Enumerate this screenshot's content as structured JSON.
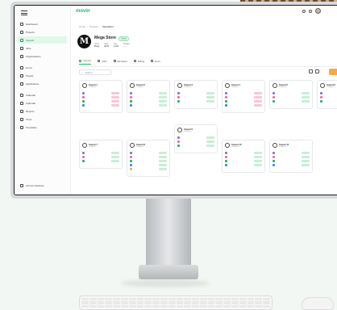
{
  "app": {
    "logo": "movin"
  },
  "colors": {
    "accent": "#27b36a",
    "accent_soft": "#e3f6ea",
    "cta": "#f7a94a",
    "frame": "#d7d9dc"
  },
  "sidebar": {
    "items": [
      {
        "label": "Dashboard",
        "icon": "grid-icon",
        "active": false
      },
      {
        "label": "Projects",
        "icon": "folder-icon",
        "active": false
      },
      {
        "label": "Squads",
        "icon": "users-icon",
        "active": true
      },
      {
        "label": "Jobs",
        "icon": "briefcase-icon",
        "active": false
      },
      {
        "label": "Organizations",
        "icon": "building-icon",
        "active": false
      }
    ],
    "section2": [
      {
        "label": "Home",
        "icon": "home-icon"
      },
      {
        "label": "People",
        "icon": "person-icon"
      },
      {
        "label": "Applications",
        "icon": "doc-icon"
      }
    ],
    "section3": [
      {
        "label": "Calendar",
        "icon": "calendar-icon"
      },
      {
        "label": "Calendar",
        "icon": "calendar-icon"
      },
      {
        "label": "Reports",
        "icon": "chart-icon"
      },
      {
        "label": "Timer",
        "icon": "clock-icon"
      },
      {
        "label": "Templates",
        "icon": "template-icon"
      }
    ],
    "bottom": {
      "label": "Account Settings",
      "icon": "gear-icon"
    }
  },
  "breadcrumb": [
    "Home",
    "Projects",
    "Squadrant"
  ],
  "project": {
    "logo_letter": "M",
    "title": "Mega Store",
    "badge": "Active",
    "meta": [
      {
        "k": "Client",
        "v": "Mega"
      },
      {
        "k": "Start",
        "v": "08/10"
      },
      {
        "k": "Due",
        "v": "12/24"
      },
      {
        "k": "Budget",
        "v": "—"
      }
    ]
  },
  "tabs": [
    {
      "label": "Squads",
      "active": true
    },
    {
      "label": "Jobs",
      "active": false
    },
    {
      "label": "Members",
      "active": false
    },
    {
      "label": "Billing",
      "active": false
    },
    {
      "label": "Docs",
      "active": false
    }
  ],
  "filter": {
    "placeholder": "Search"
  },
  "cards": [
    {
      "title": "Squad 1",
      "sub": "Designers",
      "rows": 4,
      "pill": "#f6c7d8"
    },
    {
      "title": "Squad 2",
      "sub": "Designers",
      "rows": 4,
      "pill": "#c9edd8"
    },
    {
      "title": "Squad 3",
      "sub": "Designers",
      "rows": 3,
      "pill": "#c9edd8"
    },
    {
      "title": "Squad 4",
      "sub": "Designers",
      "rows": 4,
      "pill": "#f6c7d8"
    },
    {
      "title": "Squad 5",
      "sub": "Designers",
      "rows": 3,
      "pill": "#c9edd8"
    },
    {
      "title": "Squad 6",
      "sub": "Designers",
      "rows": 3,
      "pill": "#fbe3b5"
    },
    {
      "title": "Squad 7",
      "sub": "Designers",
      "rows": 3,
      "pill": "#c9edd8"
    },
    {
      "title": "Squad 8",
      "sub": "Designers",
      "rows": 5,
      "pill": "#c9edd8"
    },
    {
      "title": "Squad 9",
      "sub": "Designers",
      "rows": 3,
      "pill": "#c9edd8"
    },
    {
      "title": "Squad 10",
      "sub": "Designers",
      "rows": 4,
      "pill": "#c9edd8"
    },
    {
      "title": "Squad 11",
      "sub": "Designers",
      "rows": 4,
      "pill": "#c9edd8"
    }
  ]
}
